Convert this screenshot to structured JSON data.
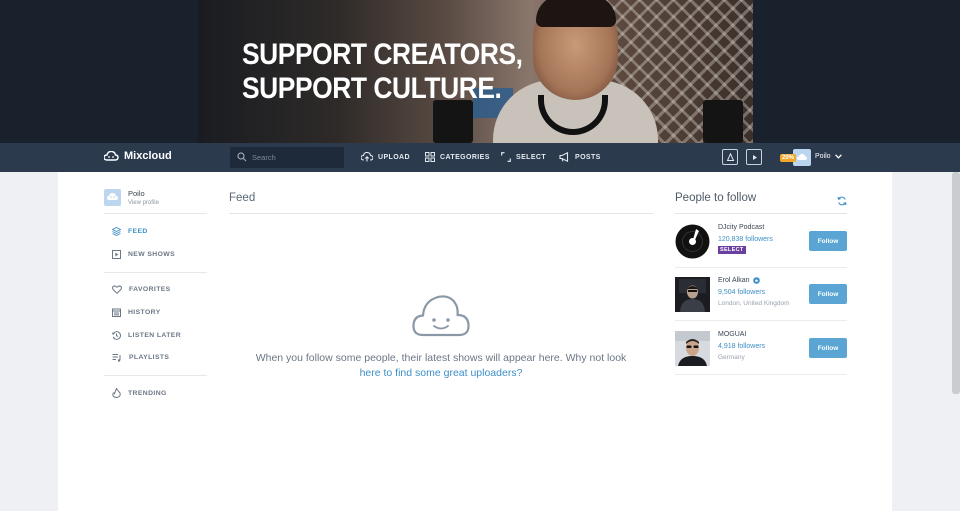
{
  "banner": {
    "line1": "SUPPORT CREATORS,",
    "line2": "SUPPORT CULTURE."
  },
  "nav": {
    "logo_text": "Mixcloud",
    "search_placeholder": "Search",
    "items": [
      {
        "label": "UPLOAD",
        "icon": "upload-cloud-icon"
      },
      {
        "label": "CATEGORIES",
        "icon": "grid-icon"
      },
      {
        "label": "SELECT",
        "icon": "select-brackets-icon"
      },
      {
        "label": "POSTS",
        "icon": "megaphone-icon"
      }
    ],
    "profile_completion": "20%",
    "username": "Poilo"
  },
  "sidebar": {
    "profile_name": "Poilo",
    "profile_link": "View profile",
    "items": [
      {
        "label": "FEED",
        "icon": "stack-icon",
        "active": true
      },
      {
        "label": "NEW SHOWS",
        "icon": "play-square-icon"
      },
      {
        "label": "FAVORITES",
        "icon": "heart-icon"
      },
      {
        "label": "HISTORY",
        "icon": "calendar-icon"
      },
      {
        "label": "LISTEN LATER",
        "icon": "clock-history-icon"
      },
      {
        "label": "PLAYLISTS",
        "icon": "playlist-icon"
      },
      {
        "label": "TRENDING",
        "icon": "flame-icon"
      }
    ]
  },
  "feed": {
    "title": "Feed",
    "empty_text": "When you follow some people, their latest shows will appear here. Why not look",
    "empty_link": "here to find some great uploaders?"
  },
  "people_to_follow": {
    "title": "People to follow",
    "follow_label": "Follow",
    "people": [
      {
        "name": "DJcity Podcast",
        "followers": "120,838 followers",
        "badge": "SELECT"
      },
      {
        "name": "Erol Alkan",
        "followers": "9,504 followers",
        "location": "London, United Kingdom"
      },
      {
        "name": "MOGUAI",
        "followers": "4,918 followers",
        "location": "Germany"
      }
    ]
  },
  "colors": {
    "accent": "#3d8fc6",
    "navbar": "#2b3a4d",
    "follow_button": "#5aa5d4",
    "select_badge": "#6b3fa0"
  }
}
